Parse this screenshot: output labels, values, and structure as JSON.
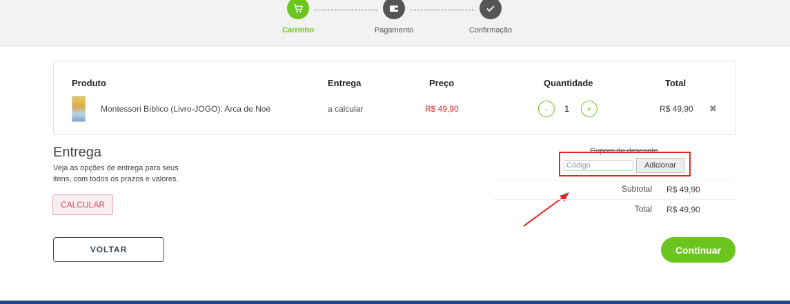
{
  "steps": {
    "cart": "Carrinho",
    "payment": "Pagamento",
    "confirmation": "Confirmação"
  },
  "colors": {
    "accent": "#6cc51e",
    "price": "#e02424",
    "footer": "#1e4a8a"
  },
  "table": {
    "headers": {
      "product": "Produto",
      "delivery": "Entrega",
      "price": "Preço",
      "quantity": "Quantidade",
      "total": "Total"
    },
    "row": {
      "product": "Montessori Bíblico (Livro-JOGO): Arca de Noé",
      "delivery": "a calcular",
      "price": "R$ 49,90",
      "quantity": "1",
      "total": "R$ 49,90",
      "minus": "-",
      "plus": "+",
      "remove": "✖"
    }
  },
  "delivery": {
    "title": "Entrega",
    "description": "Veja as opções de entrega para seus itens, com todos os prazos e valores.",
    "calc_button": "CALCULAR"
  },
  "coupon": {
    "title": "Cupom de desconto",
    "placeholder": "Código",
    "add_button": "Adicionar"
  },
  "summary": {
    "subtotal_label": "Subtotal",
    "subtotal_value": "R$ 49,90",
    "total_label": "Total",
    "total_value": "R$ 49,90"
  },
  "actions": {
    "back": "VOLTAR",
    "continue": "Continuar"
  }
}
